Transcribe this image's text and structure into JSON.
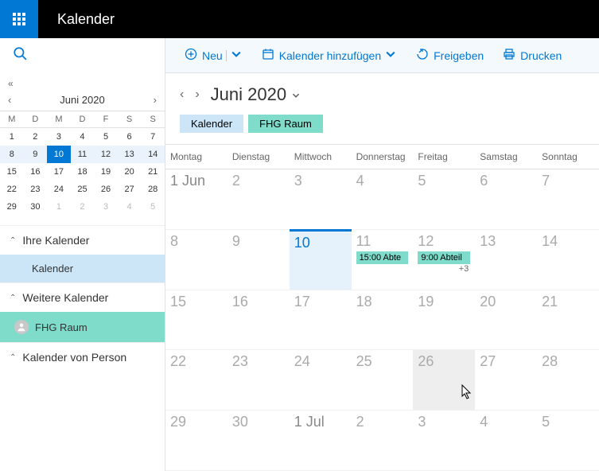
{
  "header": {
    "app_title": "Kalender"
  },
  "toolbar": {
    "new_label": "Neu",
    "add_calendar_label": "Kalender hinzufügen",
    "share_label": "Freigeben",
    "print_label": "Drucken"
  },
  "mini_calendar": {
    "title": "Juni 2020",
    "day_headers": [
      "M",
      "D",
      "M",
      "D",
      "F",
      "S",
      "S"
    ],
    "weeks": [
      [
        {
          "n": "1"
        },
        {
          "n": "2"
        },
        {
          "n": "3"
        },
        {
          "n": "4"
        },
        {
          "n": "5"
        },
        {
          "n": "6"
        },
        {
          "n": "7"
        }
      ],
      [
        {
          "n": "8"
        },
        {
          "n": "9"
        },
        {
          "n": "10",
          "selected": true
        },
        {
          "n": "11"
        },
        {
          "n": "12"
        },
        {
          "n": "13"
        },
        {
          "n": "14"
        }
      ],
      [
        {
          "n": "15"
        },
        {
          "n": "16"
        },
        {
          "n": "17"
        },
        {
          "n": "18"
        },
        {
          "n": "19"
        },
        {
          "n": "20"
        },
        {
          "n": "21"
        }
      ],
      [
        {
          "n": "22"
        },
        {
          "n": "23"
        },
        {
          "n": "24"
        },
        {
          "n": "25"
        },
        {
          "n": "26"
        },
        {
          "n": "27"
        },
        {
          "n": "28"
        }
      ],
      [
        {
          "n": "29"
        },
        {
          "n": "30"
        },
        {
          "n": "1",
          "dim": true
        },
        {
          "n": "2",
          "dim": true
        },
        {
          "n": "3",
          "dim": true
        },
        {
          "n": "4",
          "dim": true
        },
        {
          "n": "5",
          "dim": true
        }
      ]
    ]
  },
  "sidebar": {
    "groups": [
      {
        "title": "Ihre Kalender",
        "items": [
          {
            "label": "Kalender",
            "color": "blue"
          }
        ]
      },
      {
        "title": "Weitere Kalender",
        "items": [
          {
            "label": "FHG Raum",
            "color": "teal",
            "avatar": true
          }
        ]
      },
      {
        "title": "Kalender von Person",
        "items": []
      }
    ]
  },
  "view": {
    "title": "Juni 2020",
    "chips": [
      {
        "label": "Kalender",
        "color": "blue"
      },
      {
        "label": "FHG Raum",
        "color": "teal"
      }
    ],
    "day_headers": [
      "Montag",
      "Dienstag",
      "Mittwoch",
      "Donnerstag",
      "Freitag",
      "Samstag",
      "Sonntag"
    ],
    "weeks": [
      [
        {
          "label": "1 Jun",
          "month": true
        },
        {
          "label": "2"
        },
        {
          "label": "3"
        },
        {
          "label": "4"
        },
        {
          "label": "5"
        },
        {
          "label": "6"
        },
        {
          "label": "7"
        }
      ],
      [
        {
          "label": "8"
        },
        {
          "label": "9"
        },
        {
          "label": "10",
          "today": true
        },
        {
          "label": "11",
          "events": [
            {
              "text": "15:00 Abte"
            }
          ]
        },
        {
          "label": "12",
          "events": [
            {
              "text": "9:00 Abteil"
            }
          ],
          "more": "+3"
        },
        {
          "label": "13"
        },
        {
          "label": "14"
        }
      ],
      [
        {
          "label": "15"
        },
        {
          "label": "16"
        },
        {
          "label": "17"
        },
        {
          "label": "18"
        },
        {
          "label": "19"
        },
        {
          "label": "20"
        },
        {
          "label": "21"
        }
      ],
      [
        {
          "label": "22"
        },
        {
          "label": "23"
        },
        {
          "label": "24"
        },
        {
          "label": "25"
        },
        {
          "label": "26",
          "hover": true
        },
        {
          "label": "27"
        },
        {
          "label": "28"
        }
      ],
      [
        {
          "label": "29"
        },
        {
          "label": "30"
        },
        {
          "label": "1 Jul",
          "month": true
        },
        {
          "label": "2"
        },
        {
          "label": "3"
        },
        {
          "label": "4"
        },
        {
          "label": "5"
        }
      ]
    ]
  }
}
